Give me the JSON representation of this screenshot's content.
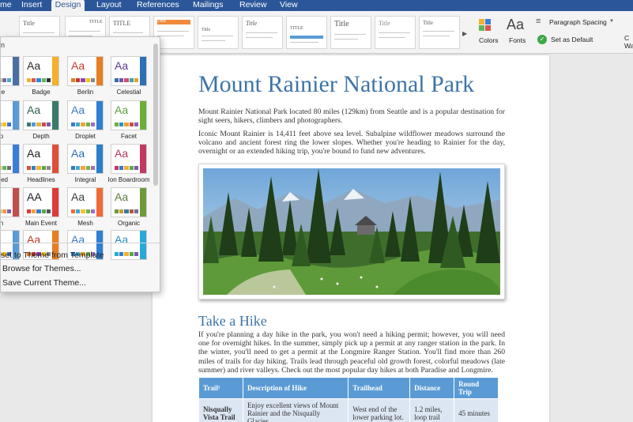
{
  "ribbon_tabs": [
    "me",
    "Insert",
    "Design",
    "Layout",
    "References",
    "Mailings",
    "Review",
    "View"
  ],
  "active_tab": "Design",
  "style_gallery": {
    "thumbs": [
      "Title",
      "TITLE",
      "TITLE",
      "Title",
      "Title",
      "Title",
      "TITLE",
      "Title",
      "Title",
      "Title",
      "Title"
    ]
  },
  "ribbon_buttons": {
    "colors": "Colors",
    "fonts": "Fonts",
    "fonts_glyph": "Aa",
    "paragraph_spacing": "Paragraph Spacing",
    "set_as_default": "Set as Default",
    "watermark_partial": "C\nWa"
  },
  "themes_popup": {
    "header": "n",
    "themes": [
      {
        "name": "ce",
        "aa": "Aa",
        "accent": "#4a6fa5",
        "colors": [
          "#4a6fa5",
          "#c0504d",
          "#9bbb59",
          "#8064a2",
          "#4bacc6"
        ]
      },
      {
        "name": "Badge",
        "aa": "Aa",
        "accent": "#2a2a2a",
        "colors": [
          "#f4b12c",
          "#d9534f",
          "#3b7dd8",
          "#5cb85c",
          "#333333"
        ]
      },
      {
        "name": "Berlin",
        "aa": "Aa",
        "accent": "#c0392b",
        "colors": [
          "#e67e22",
          "#c0392b",
          "#8e44ad",
          "#f1c40f",
          "#7f8c8d"
        ]
      },
      {
        "name": "Celestial",
        "aa": "Aa",
        "accent": "#5b3a8a",
        "colors": [
          "#2f6fb3",
          "#7a4ea3",
          "#c94f7c",
          "#3aa6a0",
          "#e0a030"
        ]
      },
      {
        "name": "p",
        "aa": "Aa",
        "accent": "#555555",
        "colors": [
          "#5b9bd5",
          "#ed7d31",
          "#a5a5a5",
          "#ffc000",
          "#4472c4"
        ]
      },
      {
        "name": "Depth",
        "aa": "Aa",
        "accent": "#2e5e4e",
        "colors": [
          "#3a7a6a",
          "#4f9bd5",
          "#e8b04a",
          "#c04e4e",
          "#7a5aa8"
        ]
      },
      {
        "name": "Droplet",
        "aa": "Aa",
        "accent": "#3a78c2",
        "colors": [
          "#2f7fd2",
          "#43a9c9",
          "#f0a33c",
          "#6fb04a",
          "#9a6fc0"
        ]
      },
      {
        "name": "Facet",
        "aa": "Aa",
        "accent": "#5a9e3a",
        "colors": [
          "#6cae3a",
          "#2f8fc2",
          "#f0a030",
          "#c64d4d",
          "#8f5fb0"
        ]
      },
      {
        "name": "ered",
        "aa": "Aa",
        "accent": "#3a3a3a",
        "colors": [
          "#3b7dd8",
          "#d9534f",
          "#f0ad4e",
          "#5cb85c",
          "#6f6f6f"
        ]
      },
      {
        "name": "Headlines",
        "aa": "Aa",
        "accent": "#1f1f1f",
        "colors": [
          "#e04f3a",
          "#2f80c2",
          "#f2b134",
          "#5aa64a",
          "#8a8a8a"
        ]
      },
      {
        "name": "Integral",
        "aa": "Aa",
        "accent": "#2a6fb0",
        "colors": [
          "#2a7fc8",
          "#4aa8d8",
          "#f2a33a",
          "#7ab648",
          "#9a6fc0"
        ]
      },
      {
        "name": "Ion Boardroom",
        "aa": "Aa",
        "accent": "#b03a5a",
        "colors": [
          "#c0395e",
          "#3a7ac0",
          "#f2b134",
          "#5aa64a",
          "#7a5aa8"
        ]
      },
      {
        "name": "n",
        "aa": "Aa",
        "accent": "#7a1f1f",
        "colors": [
          "#c0504d",
          "#4f81bd",
          "#9bbb59",
          "#f79646",
          "#8064a2"
        ]
      },
      {
        "name": "Main Event",
        "aa": "AA",
        "accent": "#1f1f1f",
        "colors": [
          "#e03a3a",
          "#f2a33a",
          "#3a7ac0",
          "#5aa64a",
          "#555555"
        ]
      },
      {
        "name": "Mesh",
        "aa": "Aa",
        "accent": "#3a3a3a",
        "colors": [
          "#f06a35",
          "#3aa6d8",
          "#f2c12e",
          "#6fb04a",
          "#9a6fc0"
        ]
      },
      {
        "name": "Organic",
        "aa": "Aa",
        "accent": "#5a7a3a",
        "colors": [
          "#6e9b3a",
          "#c89b3a",
          "#3a7a9b",
          "#b05a3a",
          "#7a6a9b"
        ]
      },
      {
        "name": "",
        "aa": "Aa",
        "accent": "#555555",
        "colors": [
          "#5b9bd5",
          "#ed7d31",
          "#a5a5a5",
          "#ffc000",
          "#4472c4"
        ]
      },
      {
        "name": "",
        "aa": "Aa",
        "accent": "#c0392b",
        "colors": [
          "#e67e22",
          "#c0392b",
          "#8e44ad",
          "#f1c40f",
          "#7f8c8d"
        ]
      },
      {
        "name": "",
        "aa": "Aa",
        "accent": "#3a78c2",
        "colors": [
          "#2f7fd2",
          "#43a9c9",
          "#f0a33c",
          "#6fb04a",
          "#9a6fc0"
        ]
      },
      {
        "name": "",
        "aa": "Aa",
        "accent": "#2a8fc2",
        "colors": [
          "#2aa8d8",
          "#3a7ac0",
          "#f2b134",
          "#5aa64a",
          "#7a5aa8"
        ]
      }
    ],
    "menu": [
      "set to Theme from Template",
      "Browse for Themes...",
      "Save Current Theme..."
    ]
  },
  "document": {
    "title": "Mount Rainier National Park",
    "intro1": "Mount Rainier National Park located 80 miles (129km) from Seattle and is a popular destination for sight seers, hikers, climbers and photographers.",
    "intro2": "Iconic Mount Rainier is 14,411 feet above sea level. Subalpine wildflower meadows surround the volcano and ancient forest ring the lower slopes. Whether you're heading to Rainier for the day, overnight or an extended hiking trip, you're bound to fund new adventures.",
    "hike_heading": "Take a Hike",
    "hike_text": "If you're planning a day hike in the park, you won't need a hiking permit; however, you will need one for overnight hikes. In the summer, simply pick up a permit at any ranger station in the park. In the winter, you'll need to get a permit at the Longmire Ranger Station. You'll find more than 260 miles of trails for day hiking. Trails lead through peaceful old growth forest, colorful meadows (late summer) and river valleys. Check out the most popular day hikes at both Paradise and Longmire.",
    "table": {
      "headers": [
        "Trail¹",
        "Description of Hike",
        "Trailhead",
        "Distance",
        "Round Trip"
      ],
      "rows": [
        [
          "Nisqually Vista Trail",
          "Enjoy excellent views of Mount Rainier and the Nisqually Glacier.",
          "West end of the lower parking lot.",
          "1.2 miles, loop trail",
          "45 minutes"
        ],
        [
          "",
          "",
          "",
          "",
          ""
        ]
      ]
    }
  }
}
